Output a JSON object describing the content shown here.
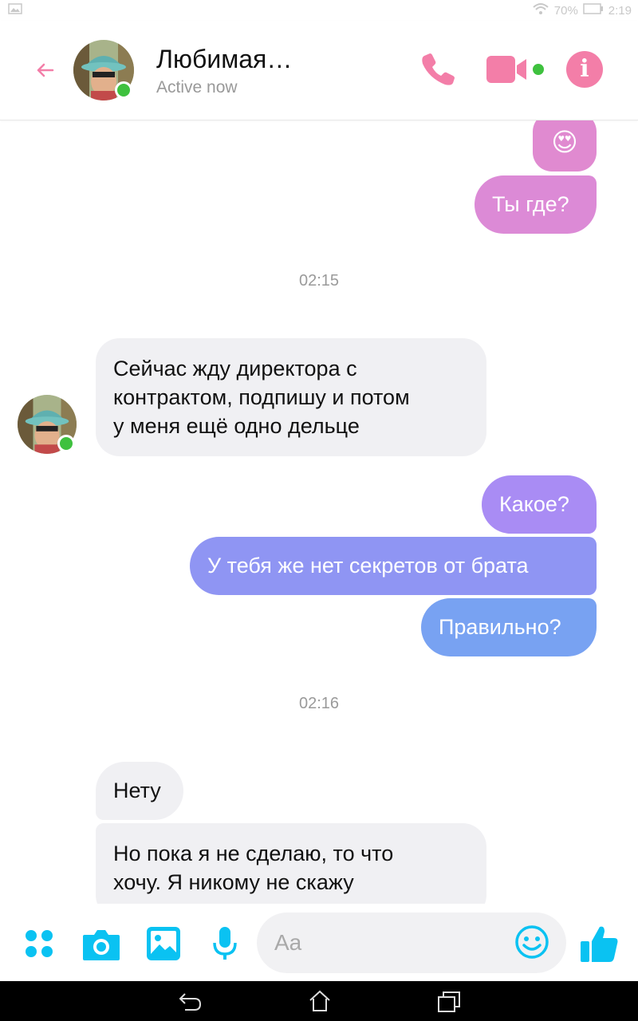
{
  "status_bar": {
    "battery": "70%",
    "clock": "2:19"
  },
  "header": {
    "contact_name": "Любимая…",
    "presence": "Active now"
  },
  "messages": {
    "emoji": "😍",
    "m1": "Ты где?",
    "time1": "02:15",
    "m2_line1": "Сейчас жду директора с",
    "m2_line2": "контрактом, подпишу и потом",
    "m2_line3": "у меня ещё одно дельце",
    "m3": "Какое?",
    "m4": "У тебя же нет секретов от брата",
    "m5": "Правильно?",
    "time2": "02:16",
    "m6": "Нету",
    "m7_line1": "Но пока я не сделаю, то что",
    "m7_line2": "хочу. Я никому не скажу"
  },
  "composer": {
    "placeholder": "Aa"
  },
  "icons": {
    "back": "arrow-left-icon",
    "call": "phone-icon",
    "video": "video-camera-icon",
    "info": "info-icon",
    "menu": "four-dots-icon",
    "camera": "camera-icon",
    "gallery": "image-icon",
    "mic": "microphone-icon",
    "emoji": "smiley-icon",
    "like": "thumbs-up-icon"
  },
  "colors": {
    "accent_pink": "#f37ea8",
    "composer_blue": "#0ac2f2",
    "out_pink": "#e08ad0",
    "out_purple": "#a58cf5",
    "out_blue": "#7b9ef2"
  }
}
